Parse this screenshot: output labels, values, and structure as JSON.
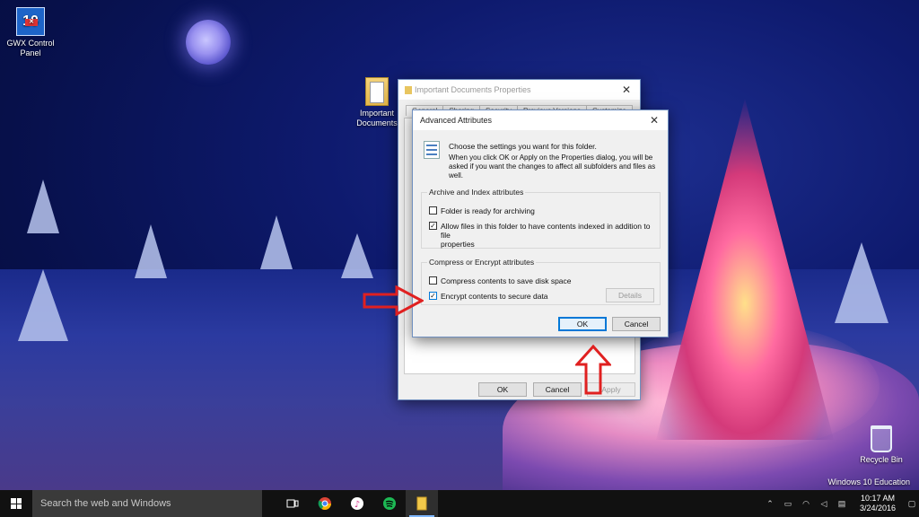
{
  "desktop": {
    "icons": [
      {
        "label_line1": "GWX Control",
        "label_line2": "Panel",
        "glyph_text": "10"
      },
      {
        "label_line1": "Important",
        "label_line2": "Documents"
      },
      {
        "label_line1": "Recycle Bin",
        "label_line2": ""
      }
    ],
    "watermark": "Windows 10 Education"
  },
  "properties_window": {
    "title": "Important Documents Properties",
    "tabs": [
      "General",
      "Sharing",
      "Security",
      "Previous Versions",
      "Customize"
    ],
    "buttons": {
      "ok": "OK",
      "cancel": "Cancel",
      "apply": "Apply"
    }
  },
  "advanced_dialog": {
    "title": "Advanced Attributes",
    "intro_line": "Choose the settings you want for this folder.",
    "intro_detail": "When you click OK or Apply on the Properties dialog, you will be asked if you want the changes to affect all subfolders and files as well.",
    "archive_group": {
      "title": "Archive and Index attributes",
      "archiving_label": "Folder is ready for archiving",
      "archiving_checked": false,
      "index_label_1": "Allow files in this folder to have contents indexed in addition to file",
      "index_label_2": "properties",
      "index_checked": true
    },
    "encrypt_group": {
      "title": "Compress or Encrypt attributes",
      "compress_label": "Compress contents to save disk space",
      "compress_checked": false,
      "encrypt_label": "Encrypt contents to secure data",
      "encrypt_checked": true,
      "details_label": "Details"
    },
    "buttons": {
      "ok": "OK",
      "cancel": "Cancel"
    }
  },
  "taskbar": {
    "search_placeholder": "Search the web and Windows",
    "apps": [
      "task-view",
      "chrome",
      "itunes",
      "spotify",
      "file-explorer"
    ],
    "clock_time": "10:17 AM",
    "clock_date": "3/24/2016"
  },
  "colors": {
    "accent": "#0078d7",
    "arrow_red": "#e02020"
  }
}
